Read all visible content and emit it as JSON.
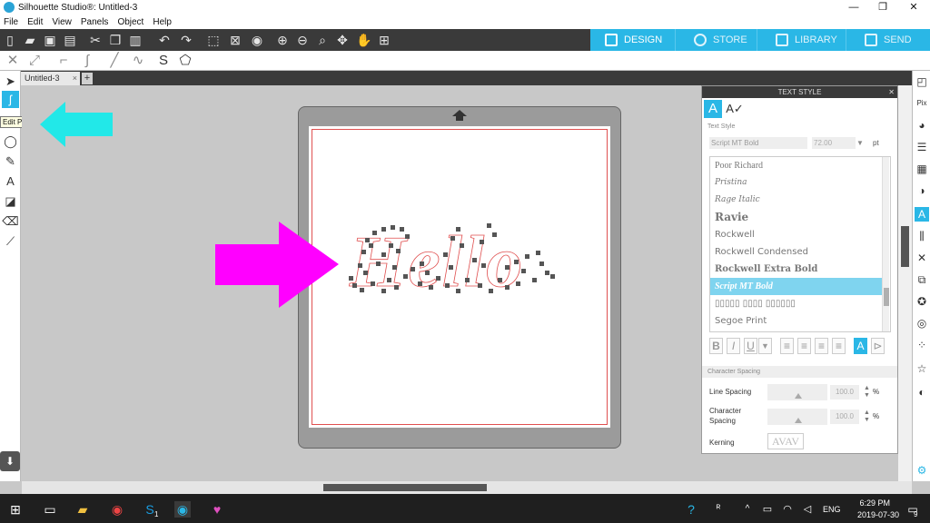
{
  "window": {
    "title": "Silhouette Studio®: Untitled-3",
    "minimize": "—",
    "maximize": "❐",
    "close": "✕"
  },
  "menu": [
    "File",
    "Edit",
    "View",
    "Panels",
    "Object",
    "Help"
  ],
  "nav": {
    "design": "DESIGN",
    "store": "STORE",
    "library": "LIBRARY",
    "send": "SEND"
  },
  "document_tab": {
    "name": "Untitled-3",
    "close": "×",
    "add": "+"
  },
  "tooltip": "Edit Points",
  "design_text": "Hello",
  "panel": {
    "title": "TEXT STYLE",
    "close": "✕",
    "tab_text_icon": "A",
    "tab_format_icon": "A✓",
    "section_text_style": "Text Style",
    "font_name": "Script MT Bold",
    "font_size": "72.00",
    "font_size_arrow": "▼",
    "font_unit": "pt",
    "fonts": [
      "Poor Richard",
      "Pristina",
      "Rage Italic",
      "Ravie",
      "Rockwell",
      "Rockwell Condensed",
      "Rockwell Extra Bold",
      "Script MT Bold",
      "▯▯▯▯▯ ▯▯▯▯ ▯▯▯▯▯▯",
      "Segoe Print"
    ],
    "selected_font": "Script MT Bold",
    "format_buttons": {
      "bold": "B",
      "italic": "I",
      "underline": "U",
      "more": "▼",
      "align_left": "≡",
      "align_center": "≡",
      "align_right": "≡",
      "justify": "≡",
      "text_on_path": "A",
      "text_vertical": "⊳"
    },
    "section_spacing": "Character Spacing",
    "line_spacing_label": "Line Spacing",
    "line_spacing_value": "100.0",
    "char_spacing_label": "Character Spacing",
    "char_spacing_value": "100.0",
    "pct": "%",
    "kerning_label": "Kerning",
    "kerning_preview": "AVAV"
  },
  "taskbar": {
    "time": "6:29 PM",
    "date": "2019-07-30",
    "lang": "ENG",
    "badge_notif": "9",
    "skype_badge": "1"
  },
  "colors": {
    "accent": "#2ab7e6",
    "annotation_cyan": "#22e8e8",
    "annotation_magenta": "#ff00ff",
    "cut_line": "#e05050"
  }
}
